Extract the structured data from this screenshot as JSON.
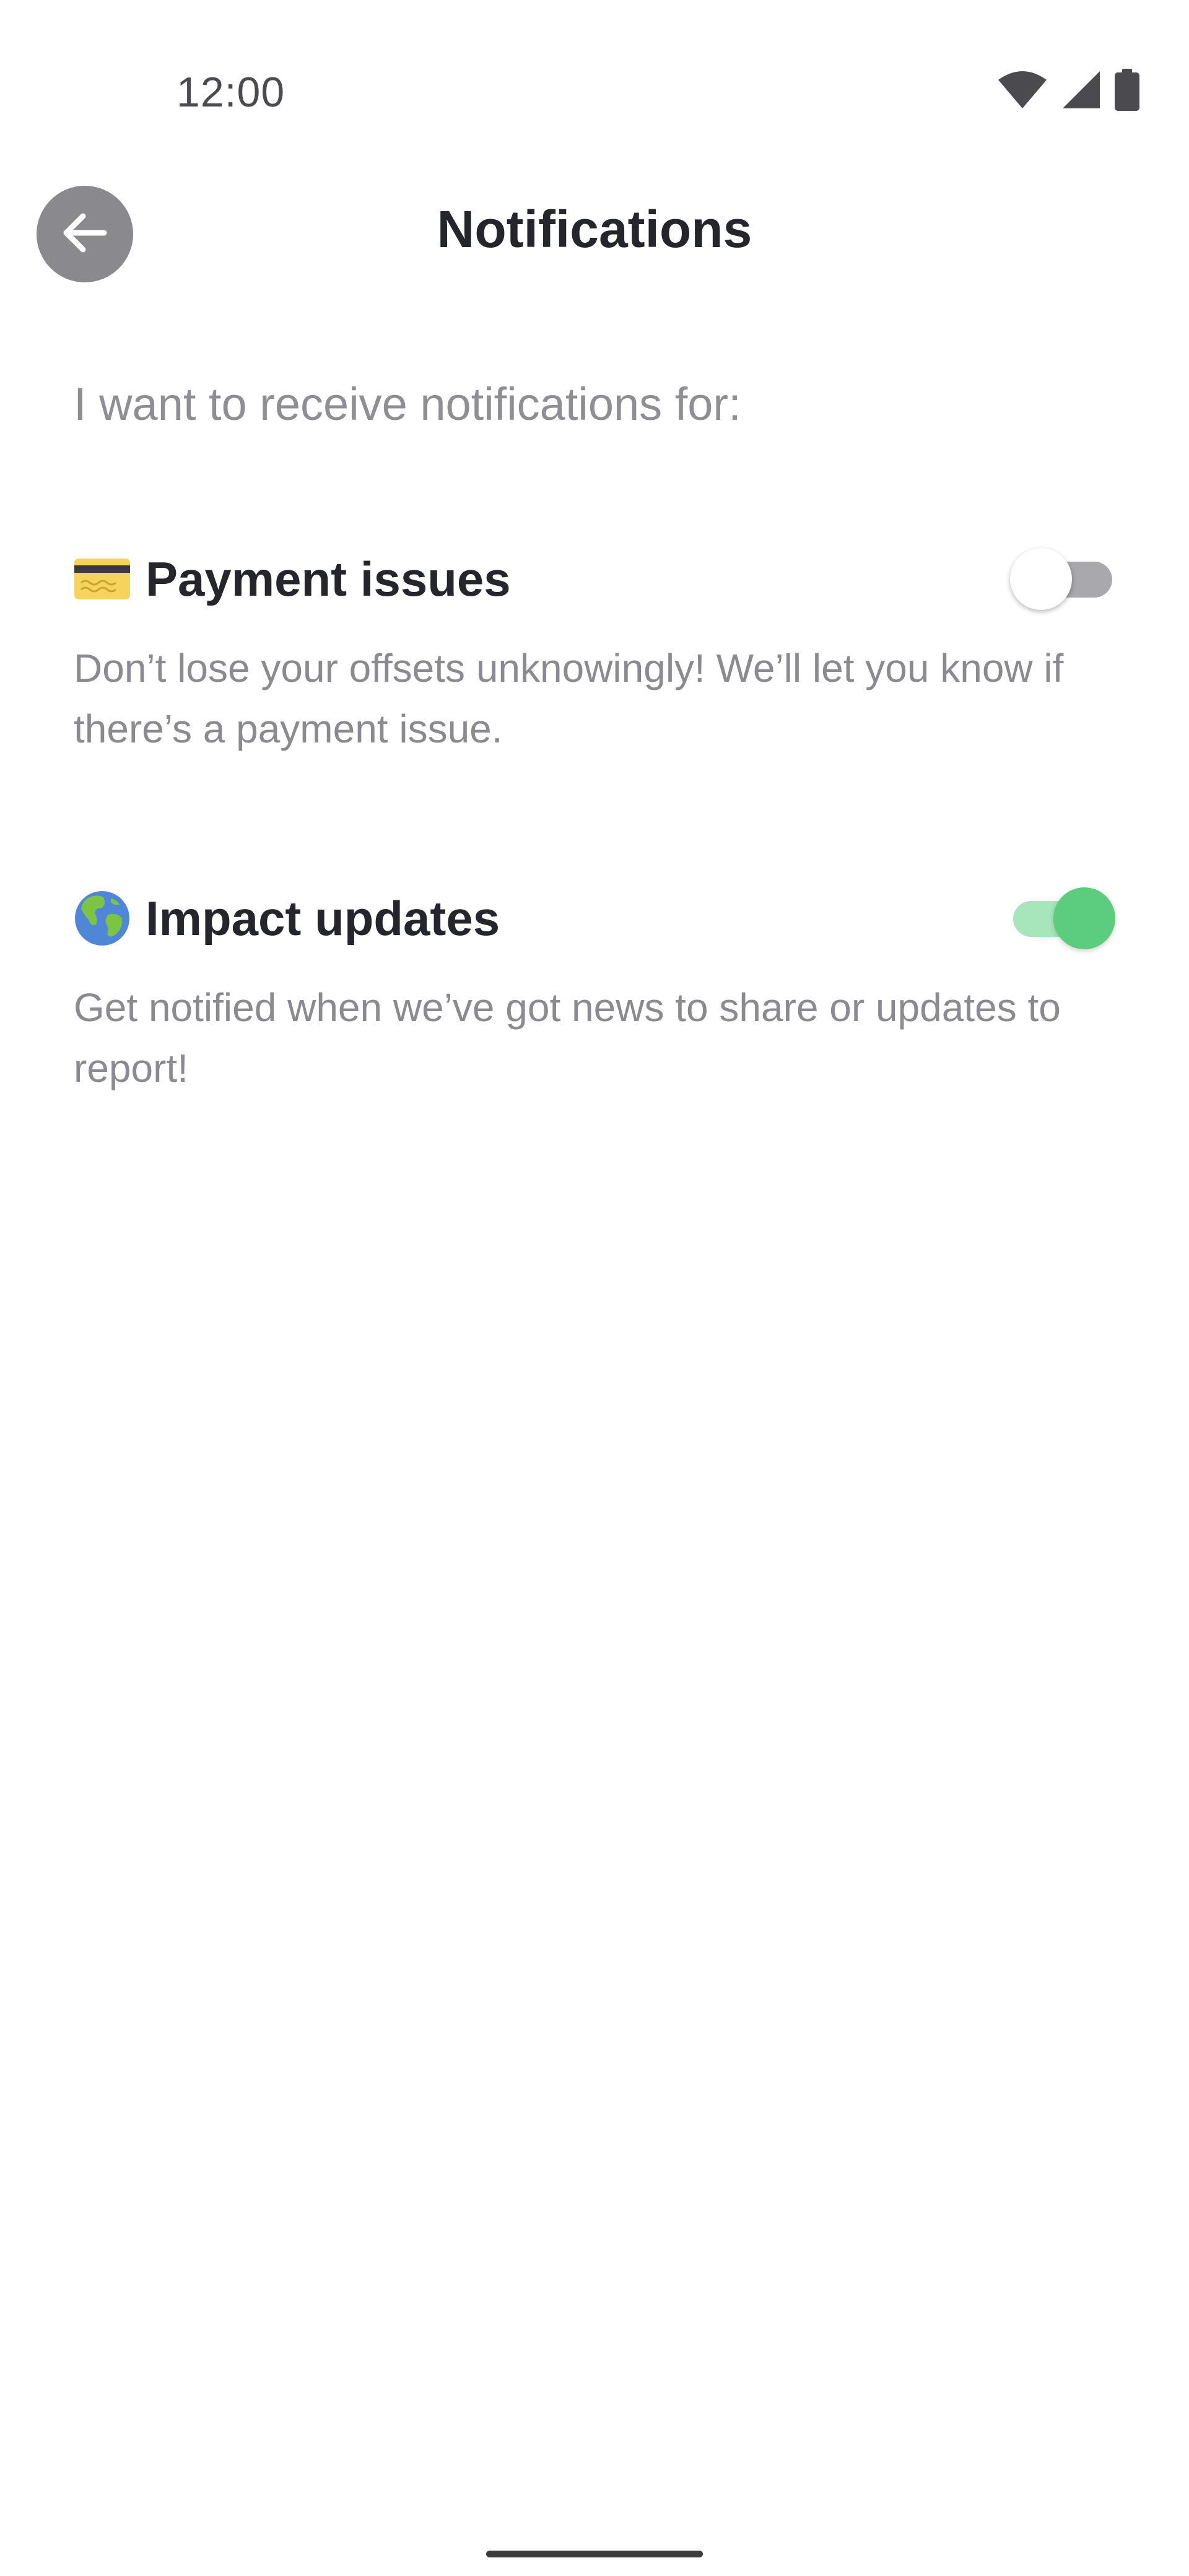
{
  "status_bar": {
    "time": "12:00",
    "icons": [
      "wifi-icon",
      "signal-icon",
      "battery-icon"
    ]
  },
  "header": {
    "title": "Notifications",
    "back_icon": "arrow-left-icon"
  },
  "intro_text": "I want to receive notifications for:",
  "settings": [
    {
      "icon": "credit-card-icon",
      "title": "Payment issues",
      "description": "Don’t lose your offsets unknowingly! We’ll let you know if there’s a payment issue.",
      "enabled": false
    },
    {
      "icon": "globe-icon",
      "title": "Impact updates",
      "description": "Get notified when we’ve got news to share or updates to report!",
      "enabled": true
    }
  ],
  "colors": {
    "toggle_on": "#5ccc7e",
    "toggle_on_track": "#a7e5bb",
    "toggle_off_track": "#a8a8ad",
    "back_button": "#8a8a8e",
    "title_text": "#25262b",
    "muted_text": "#8a8a8f"
  }
}
